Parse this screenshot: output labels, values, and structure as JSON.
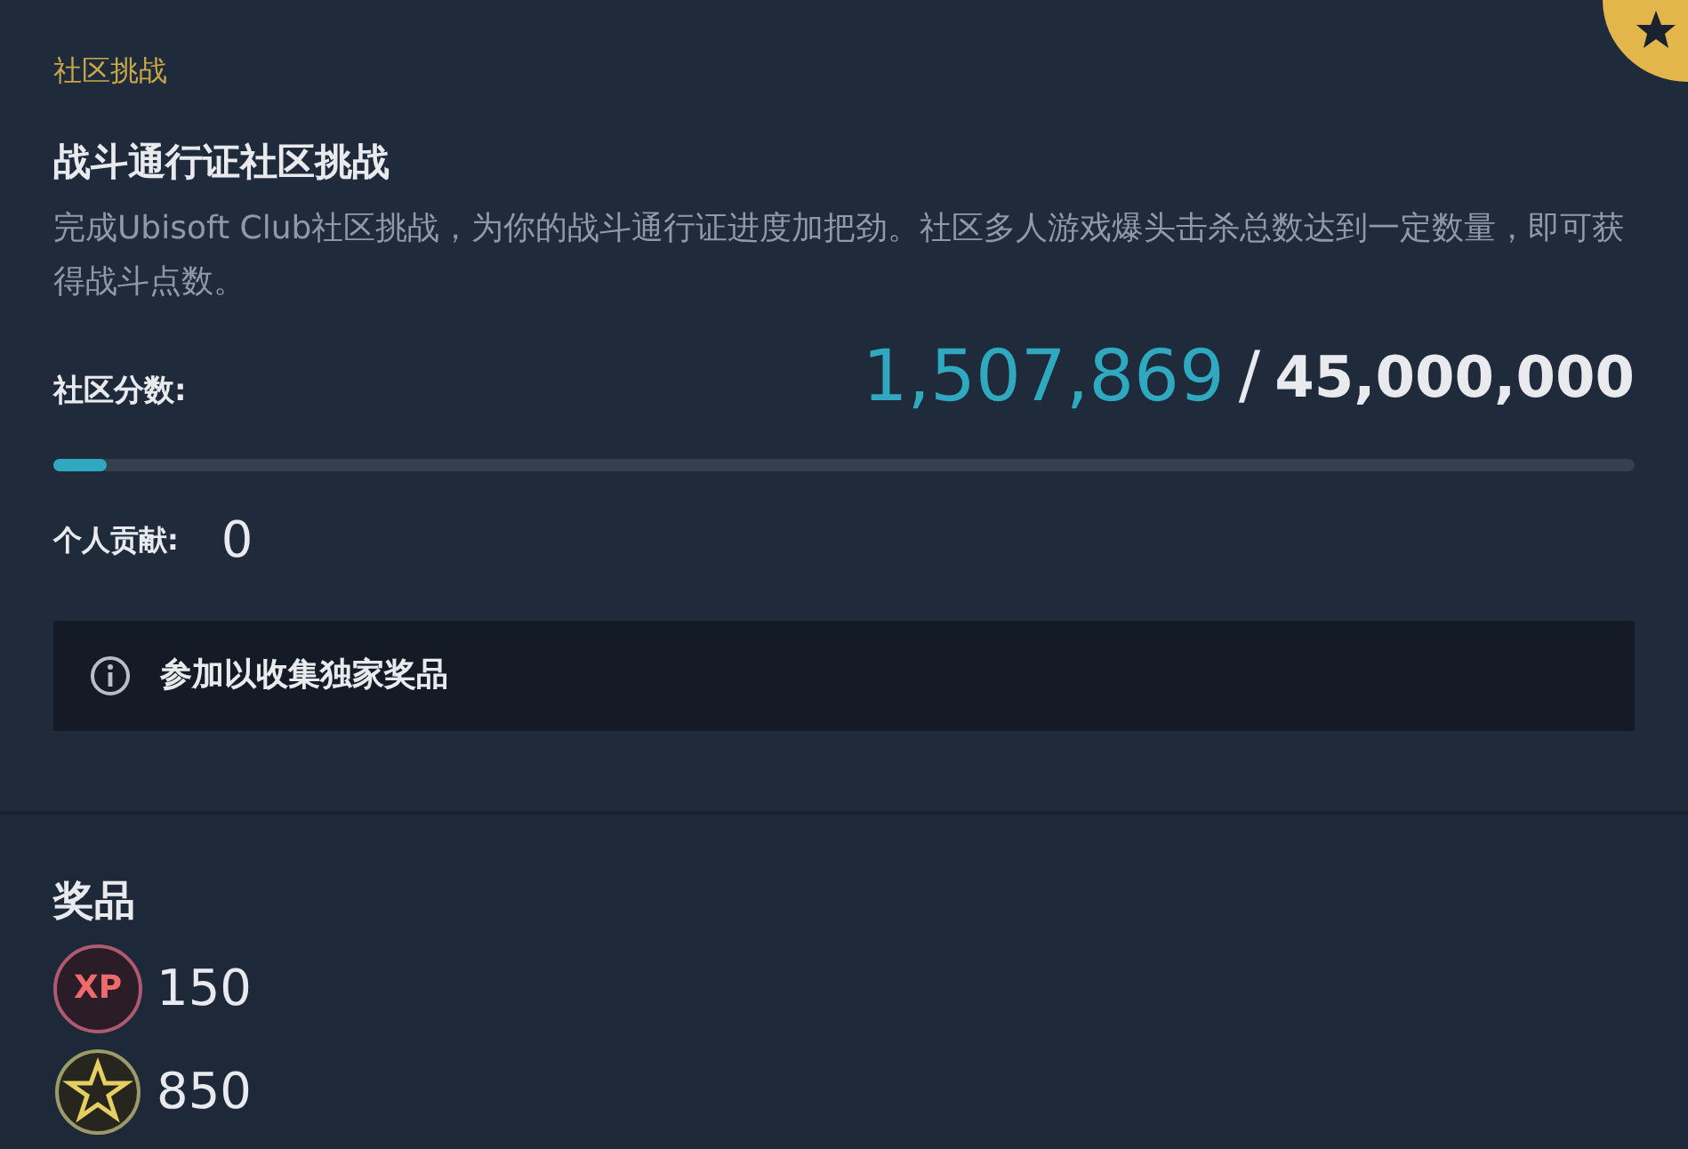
{
  "category": "社区挑战",
  "title": "战斗通行证社区挑战",
  "description": "完成Ubisoft Club社区挑战，为你的战斗通行证进度加把劲。社区多人游戏爆头击杀总数达到一定数量，即可获得战斗点数。",
  "community_score": {
    "label": "社区分数:",
    "current": "1,507,869",
    "separator": "/",
    "target": "45,000,000",
    "level": 0.034
  },
  "personal": {
    "label": "个人贡献:",
    "value": "0"
  },
  "notice": "参加以收集独家奖品",
  "rewards": {
    "heading": "奖品",
    "items": [
      {
        "kind": "xp",
        "badge": "XP",
        "amount": "150"
      },
      {
        "kind": "star",
        "amount": "850"
      }
    ]
  }
}
